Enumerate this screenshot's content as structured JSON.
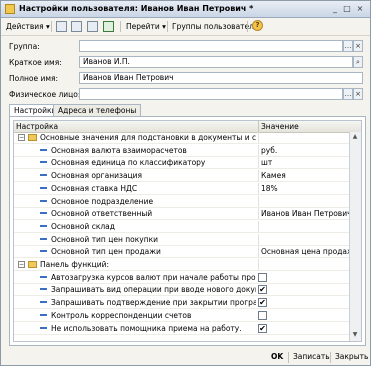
{
  "window": {
    "title": "Настройки пользователя: Иванов Иван Петрович *"
  },
  "toolbar": {
    "actions_label": "Действия",
    "go_label": "Перейти",
    "groups_label": "Группы пользователя",
    "help_symbol": "?"
  },
  "form": {
    "group": {
      "label": "Группа:",
      "value": ""
    },
    "short_name": {
      "label": "Краткое имя:",
      "value": "Иванов И.П."
    },
    "full_name": {
      "label": "Полное имя:",
      "value": "Иванов Иван Петрович"
    },
    "physical_person": {
      "label": "Физическое лицо:",
      "value": ""
    }
  },
  "tabs": [
    {
      "label": "Настройки"
    },
    {
      "label": "Адреса и телефоны"
    }
  ],
  "grid": {
    "col_setting": "Настройка",
    "col_value": "Значение",
    "rows": [
      {
        "name": "Основные значения для подстановки в документы и справ...",
        "value": ""
      },
      {
        "name": "Основная валюта взаиморасчетов",
        "value": "руб."
      },
      {
        "name": "Основная единица по классификатору",
        "value": "шт"
      },
      {
        "name": "Основная организация",
        "value": "Камея"
      },
      {
        "name": "Основная ставка НДС",
        "value": "18%"
      },
      {
        "name": "Основное подразделение",
        "value": ""
      },
      {
        "name": "Основной ответственный",
        "value": "Иванов Иван Петрович"
      },
      {
        "name": "Основной склад",
        "value": ""
      },
      {
        "name": "Основной тип цен покупки",
        "value": ""
      },
      {
        "name": "Основной тип цен продажи",
        "value": "Основная цена продажи"
      },
      {
        "name": "Панель функций:",
        "value": ""
      },
      {
        "name": "Автозагрузка курсов валют при начале работы программы",
        "value": ""
      },
      {
        "name": "Запрашивать вид операции при вводе нового документа",
        "value": "✔"
      },
      {
        "name": "Запрашивать подтверждение при закрытии программы",
        "value": "✔"
      },
      {
        "name": "Контроль корреспонденции счетов",
        "value": ""
      },
      {
        "name": "Не использовать помощника приема на работу.",
        "value": "✔"
      }
    ]
  },
  "footer": {
    "ok_label": "OK",
    "save_label": "Записать",
    "close_label": "Закрыть"
  }
}
